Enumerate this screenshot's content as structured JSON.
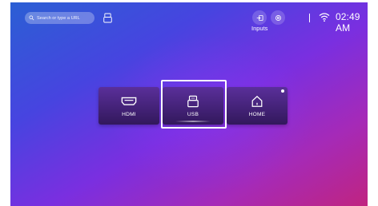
{
  "search": {
    "placeholder": "Search or type a URL"
  },
  "status_bar": {
    "inputs_label": "Inputs",
    "time": "02:49 AM",
    "icons": [
      "input-source-icon",
      "settings-icon",
      "wifi-icon"
    ]
  },
  "sources": [
    {
      "label": "HDMI",
      "icon": "hdmi-icon"
    },
    {
      "label": "USB",
      "icon": "usb-icon",
      "focused": true
    },
    {
      "label": "HOME",
      "icon": "home-icon",
      "has_notification": true
    }
  ],
  "colors": {
    "gradient_start": "#2b5fd4",
    "gradient_mid": "#7a2fe0",
    "gradient_end": "#c02480",
    "tile": "#3e1f70"
  }
}
